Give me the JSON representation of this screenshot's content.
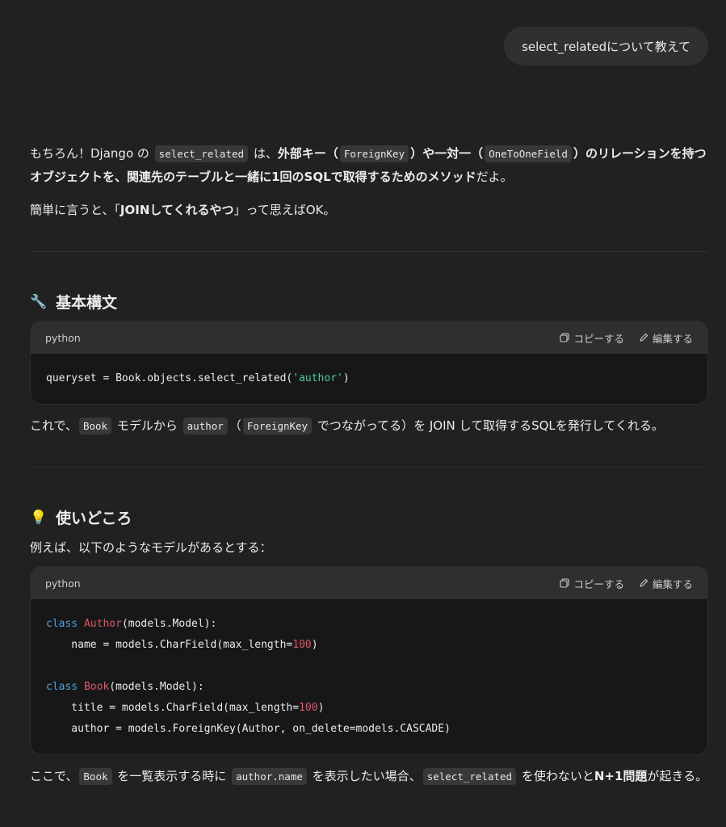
{
  "user_message": "select_relatedについて教えて",
  "intro": {
    "p1_a": "もちろん！Django の",
    "p1_code1": "select_related",
    "p1_b": "は、",
    "p1_bold1": "外部キー（",
    "p1_code2": "ForeignKey",
    "p1_bold2": "）や一対一（",
    "p1_code3": "OneToOneField",
    "p1_bold3": "）のリレーションを持つオブジェクトを、関連先のテーブルと一緒に1回のSQLで取得するためのメソッド",
    "p1_c": "だよ。",
    "p2_a": "簡単に言うと、「",
    "p2_bold": "JOINしてくれるやつ",
    "p2_b": "」って思えばOK。"
  },
  "section1": {
    "emoji": "🔧",
    "title": "基本構文",
    "code_lang": "python",
    "copy_label": "コピーする",
    "edit_label": "編集する",
    "code_line_a": "queryset = Book.objects.select_related(",
    "code_line_str": "'author'",
    "code_line_b": ")",
    "after_a": "これで、",
    "after_code1": "Book",
    "after_b": "モデルから",
    "after_code2": "author",
    "after_c": "（",
    "after_code3": "ForeignKey",
    "after_d": "でつながってる）を JOIN して取得するSQLを発行してくれる。"
  },
  "section2": {
    "emoji": "💡",
    "title": "使いどころ",
    "lead": "例えば、以下のようなモデルがあるとする：",
    "code_lang": "python",
    "copy_label": "コピーする",
    "edit_label": "編集する",
    "c1_kw": "class",
    "c1_name": "Author",
    "c1_rest": "(models.Model):",
    "c2_a": "    name = models.CharField(max_length=",
    "c2_num": "100",
    "c2_b": ")",
    "c4_kw": "class",
    "c4_name": "Book",
    "c4_rest": "(models.Model):",
    "c5_a": "    title = models.CharField(max_length=",
    "c5_num": "100",
    "c5_b": ")",
    "c6": "    author = models.ForeignKey(Author, on_delete=models.CASCADE)",
    "after_a": "ここで、",
    "after_code1": "Book",
    "after_b": "を一覧表示する時に",
    "after_code2": "author.name",
    "after_c": "を表示したい場合、",
    "after_code3": "select_related",
    "after_d": "を使わないと",
    "after_bold": "N+1問題",
    "after_e": "が起きる。"
  }
}
